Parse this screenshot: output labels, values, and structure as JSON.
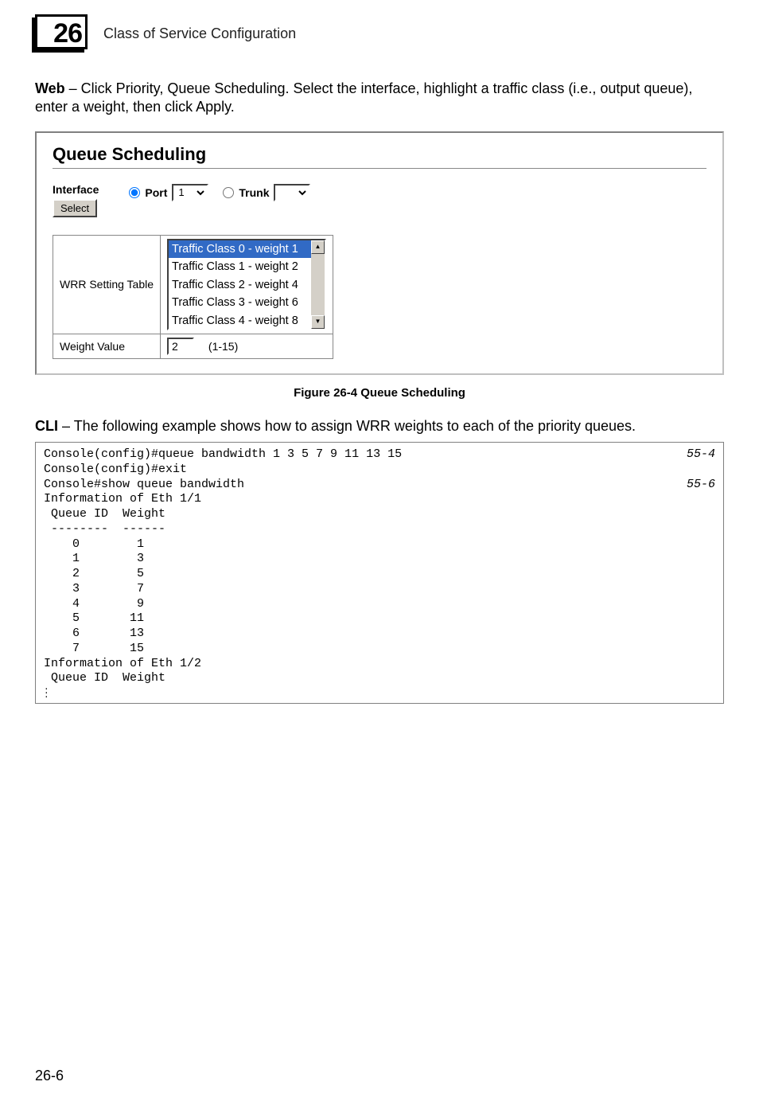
{
  "chapter": {
    "number": "26",
    "title": "Class of Service Configuration"
  },
  "web_text": {
    "prefix": "Web",
    "body": " – Click Priority, Queue Scheduling. Select the interface, highlight a traffic class (i.e., output queue), enter a weight, then click Apply."
  },
  "panel": {
    "heading": "Queue Scheduling",
    "interface_label": "Interface",
    "select_button": "Select",
    "port_label": "Port",
    "port_value": "1",
    "trunk_label": "Trunk",
    "trunk_value": "",
    "wrr_label": "WRR Setting Table",
    "wrr_items": [
      "Traffic Class 0 - weight 1",
      "Traffic Class 1 - weight 2",
      "Traffic Class 2 - weight 4",
      "Traffic Class 3 - weight 6",
      "Traffic Class 4 - weight 8"
    ],
    "wrr_selected_index": 0,
    "weight_value_label": "Weight Value",
    "weight_value": "2",
    "weight_range": "(1-15)"
  },
  "figure_caption": "Figure 26-4  Queue Scheduling",
  "cli_text": {
    "prefix": "CLI",
    "body": " – The following example shows how to assign WRR weights to each of the priority queues."
  },
  "cli": {
    "lines": [
      {
        "text": "Console(config)#queue bandwidth 1 3 5 7 9 11 13 15",
        "ref": "55-4"
      },
      {
        "text": "Console(config)#exit"
      },
      {
        "text": "Console#show queue bandwidth",
        "ref": "55-6"
      },
      {
        "text": "Information of Eth 1/1"
      },
      {
        "text": " Queue ID  Weight"
      },
      {
        "text": " --------  ------"
      },
      {
        "text": "    0        1"
      },
      {
        "text": "    1        3"
      },
      {
        "text": "    2        5"
      },
      {
        "text": "    3        7"
      },
      {
        "text": "    4        9"
      },
      {
        "text": "    5       11"
      },
      {
        "text": "    6       13"
      },
      {
        "text": "    7       15"
      },
      {
        "text": "Information of Eth 1/2"
      },
      {
        "text": " Queue ID  Weight"
      }
    ],
    "ellipsis": "..."
  },
  "page_number": "26-6"
}
